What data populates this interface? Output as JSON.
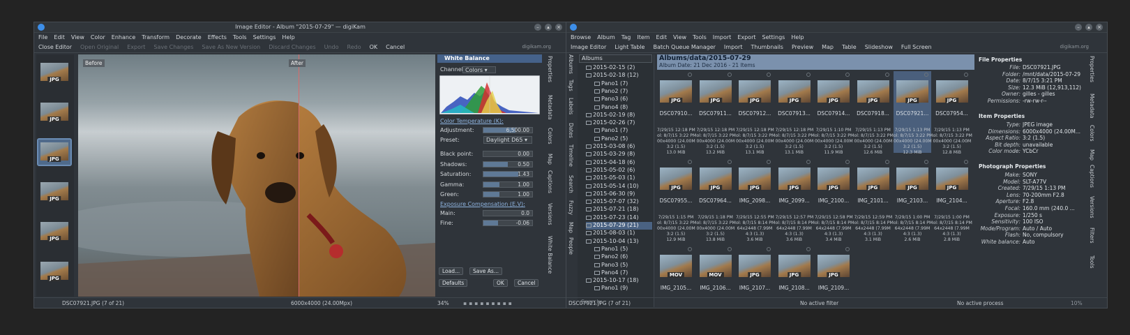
{
  "editor": {
    "title": "Image Editor - Album \"2015-07-29\" — digiKam",
    "menu": [
      "File",
      "Edit",
      "View",
      "Color",
      "Enhance",
      "Transform",
      "Decorate",
      "Effects",
      "Tools",
      "Settings",
      "Help"
    ],
    "toolbar": [
      {
        "label": "Close Editor",
        "enabled": true
      },
      {
        "label": "Open Original",
        "enabled": false
      },
      {
        "label": "Export",
        "enabled": false
      },
      {
        "label": "Save Changes",
        "enabled": false
      },
      {
        "label": "Save As New Version",
        "enabled": false
      },
      {
        "label": "Discard Changes",
        "enabled": false
      },
      {
        "label": "Undo",
        "enabled": false
      },
      {
        "label": "Redo",
        "enabled": false
      },
      {
        "label": "OK",
        "enabled": true
      },
      {
        "label": "Cancel",
        "enabled": true
      }
    ],
    "org": "digikam.org",
    "before_label": "Before",
    "after_label": "After",
    "tool_title": "White Balance",
    "channel_label": "Channel:",
    "channel_value": "Colors",
    "color_temp_label": "Color Temperature (K):",
    "adjustment_label": "Adjustment:",
    "adjustment_value": "6,500.00",
    "adjustment_level": 0.65,
    "preset_label": "Preset:",
    "preset_value": "Daylight D65",
    "sliders": [
      {
        "label": "Black point:",
        "value": "0.00",
        "level": 0.0
      },
      {
        "label": "Shadows:",
        "value": "0.50",
        "level": 0.5
      },
      {
        "label": "Saturation:",
        "value": "1.43",
        "level": 0.71
      },
      {
        "label": "Gamma:",
        "value": "1.00",
        "level": 0.33
      },
      {
        "label": "Green:",
        "value": "1.00",
        "level": 0.33
      }
    ],
    "exposure_label": "Exposure Compensation (E.V):",
    "main_label": "Main:",
    "main_value": "0.0",
    "main_level": 0.0,
    "fine_label": "Fine:",
    "fine_value": "-0.06",
    "fine_level": 0.3,
    "load_btn": "Load...",
    "saveas_btn": "Save As...",
    "defaults_btn": "Defaults",
    "ok_btn": "OK",
    "cancel_btn": "Cancel",
    "status_file": "DSC07921.JPG (7 of 21)",
    "status_size": "6000x4000 (24.00Mpx)",
    "zoom": "34%",
    "side_tabs": [
      "Properties",
      "Metadata",
      "Colors",
      "Map",
      "Captions",
      "Versions",
      "White Balance"
    ],
    "thumb_label": "JPG"
  },
  "browser": {
    "menu": [
      "Browse",
      "Album",
      "Tag",
      "Item",
      "Edit",
      "View",
      "Tools",
      "Import",
      "Export",
      "Settings",
      "Help"
    ],
    "toolbar": [
      "Image Editor",
      "Light Table",
      "Batch Queue Manager",
      "Import",
      "Thumbnails",
      "Preview",
      "Map",
      "Table",
      "Slideshow",
      "Full Screen"
    ],
    "org": "digikam.org",
    "left_tabs": [
      "Albums",
      "Tags",
      "Labels",
      "Dates",
      "Timeline",
      "Search",
      "Fuzzy",
      "Map",
      "People"
    ],
    "right_tabs": [
      "Properties",
      "Metadata",
      "Colors",
      "Map",
      "Captions",
      "Versions",
      "Filters",
      "Tools"
    ],
    "tree_header": "Albums",
    "tree": [
      {
        "label": "2015-02-15 (2)",
        "level": 1
      },
      {
        "label": "2015-02-18 (12)",
        "level": 1
      },
      {
        "label": "Pano1 (7)",
        "level": 2
      },
      {
        "label": "Pano2 (7)",
        "level": 2
      },
      {
        "label": "Pano3 (6)",
        "level": 2
      },
      {
        "label": "Pano4 (8)",
        "level": 2
      },
      {
        "label": "2015-02-19 (8)",
        "level": 1
      },
      {
        "label": "2015-02-26 (7)",
        "level": 1
      },
      {
        "label": "Pano1 (7)",
        "level": 2
      },
      {
        "label": "Pano2 (5)",
        "level": 2
      },
      {
        "label": "2015-03-08 (6)",
        "level": 1
      },
      {
        "label": "2015-03-29 (8)",
        "level": 1
      },
      {
        "label": "2015-04-18 (6)",
        "level": 1
      },
      {
        "label": "2015-05-02 (6)",
        "level": 1
      },
      {
        "label": "2015-05-03 (1)",
        "level": 1
      },
      {
        "label": "2015-05-14 (10)",
        "level": 1
      },
      {
        "label": "2015-06-30 (9)",
        "level": 1
      },
      {
        "label": "2015-07-07 (32)",
        "level": 1
      },
      {
        "label": "2015-07-21 (18)",
        "level": 1
      },
      {
        "label": "2015-07-23 (14)",
        "level": 1
      },
      {
        "label": "2015-07-29 (21)",
        "level": 1,
        "selected": true
      },
      {
        "label": "2015-08-03 (1)",
        "level": 1
      },
      {
        "label": "2015-10-04 (13)",
        "level": 1
      },
      {
        "label": "Pano1 (5)",
        "level": 2
      },
      {
        "label": "Pano2 (6)",
        "level": 2
      },
      {
        "label": "Pano3 (5)",
        "level": 2
      },
      {
        "label": "Pano4 (7)",
        "level": 2
      },
      {
        "label": "2015-10-17 (18)",
        "level": 1
      },
      {
        "label": "Pano1 (9)",
        "level": 2
      }
    ],
    "search_placeholder": "Search...",
    "album_path": "Albums/data/2015-07-29",
    "album_date": "Album Date: 21 Dec 2016 - 21 Items",
    "items": [
      {
        "name": "DSC07910...",
        "type": "JPG",
        "meta": "7/29/15 12:18 PM\nol: 8/7/15 3:22 PM\n00x4000 (24.00M\n3:2 (1.5)\n13.0 MiB"
      },
      {
        "name": "DSC07911...",
        "type": "JPG",
        "meta": "7/29/15 12:18 PM\nol: 8/7/15 3:22 PM\n00x4000 (24.00M\n3:2 (1.5)\n13.2 MiB"
      },
      {
        "name": "DSC07912...",
        "type": "JPG",
        "meta": "7/29/15 12:18 PM\nol: 8/7/15 3:22 PM\n00x4000 (24.00M\n3:2 (1.5)\n13.1 MiB"
      },
      {
        "name": "DSC07913...",
        "type": "JPG",
        "meta": "7/29/15 12:18 PM\nol: 8/7/15 3:22 PM\n00x4000 (24.00M\n3:2 (1.5)\n13.1 MiB"
      },
      {
        "name": "DSC07914...",
        "type": "JPG",
        "meta": "7/29/15 1:10 PM\nol: 8/7/15 3:22 PM\n00x4000 (24.00M\n3:2 (1.5)\n11.9 MiB"
      },
      {
        "name": "DSC07918...",
        "type": "JPG",
        "meta": "7/29/15 1:13 PM\nol: 8/7/15 3:22 PM\n00x4000 (24.00M\n3:2 (1.5)\n12.6 MiB"
      },
      {
        "name": "DSC07921...",
        "type": "JPG",
        "meta": "7/29/15 1:13 PM\nol: 8/7/15 3:22 PM\n00x4000 (24.00M\n3:2 (1.5)\n12.3 MiB",
        "selected": true
      },
      {
        "name": "DSC07954...",
        "type": "JPG",
        "meta": "7/29/15 1:13 PM\nol: 8/7/15 3:22 PM\n00x4000 (24.00M\n3:2 (1.5)\n12.8 MiB"
      },
      {
        "name": "DSC07955...",
        "type": "JPG",
        "meta": "7/29/15 1:15 PM\nol: 8/7/15 3:22 PM\n00x4000 (24.00M\n3:2 (1.5)\n12.9 MiB"
      },
      {
        "name": "DSC07964...",
        "type": "JPG",
        "meta": "7/29/15 1:18 PM\nol: 8/7/15 3:22 PM\n00x4000 (24.00M\n3:2 (1.5)\n13.8 MiB"
      },
      {
        "name": "IMG_2098...",
        "type": "JPG",
        "meta": "7/29/15 12:55 PM\nol: 8/7/15 8:14 PM\n64x2448 (7.99M\n4:3 (1.3)\n3.6 MiB"
      },
      {
        "name": "IMG_2099...",
        "type": "JPG",
        "meta": "7/29/15 12:57 PM\nol: 8/7/15 8:14 PM\n64x2448 (7.99M\n4:3 (1.3)\n3.6 MiB"
      },
      {
        "name": "IMG_2100...",
        "type": "JPG",
        "meta": "7/29/15 12:58 PM\nol: 8/7/15 8:14 PM\n64x2448 (7.99M\n4:3 (1.3)\n3.4 MiB"
      },
      {
        "name": "IMG_2101...",
        "type": "JPG",
        "meta": "7/29/15 12:59 PM\nol: 8/7/15 8:14 PM\n64x2448 (7.99M\n4:3 (1.3)\n3.1 MiB"
      },
      {
        "name": "IMG_2103...",
        "type": "JPG",
        "meta": "7/29/15 1:00 PM\nol: 8/7/15 8:14 PM\n64x2448 (7.99M\n4:3 (1.3)\n2.6 MiB"
      },
      {
        "name": "IMG_2104...",
        "type": "JPG",
        "meta": "7/29/15 1:00 PM\nol: 8/7/15 8:14 PM\n64x2448 (7.99M\n4:3 (1.3)\n2.8 MiB"
      },
      {
        "name": "IMG_2105...",
        "type": "MOV",
        "meta": ""
      },
      {
        "name": "IMG_2106...",
        "type": "MOV",
        "meta": ""
      },
      {
        "name": "IMG_2107...",
        "type": "JPG",
        "meta": ""
      },
      {
        "name": "IMG_2108...",
        "type": "JPG",
        "meta": ""
      },
      {
        "name": "IMG_2109...",
        "type": "JPG",
        "meta": ""
      }
    ],
    "file_props_title": "File Properties",
    "file_props": [
      [
        "File:",
        "DSC07921.JPG"
      ],
      [
        "Folder:",
        "/mnt/data/2015-07-29"
      ],
      [
        "Date:",
        "8/7/15 3:21 PM"
      ],
      [
        "Size:",
        "12.3 MiB (12,913,112)"
      ],
      [
        "Owner:",
        "gilles - gilles"
      ],
      [
        "Permissions:",
        "-rw-rw-r--"
      ]
    ],
    "item_props_title": "Item Properties",
    "item_props": [
      [
        "Type:",
        "JPEG image"
      ],
      [
        "Dimensions:",
        "6000x4000 (24.00M..."
      ],
      [
        "Aspect Ratio:",
        "3:2 (1.5)"
      ],
      [
        "Bit depth:",
        "unavailable"
      ],
      [
        "Color mode:",
        "YCbCr"
      ]
    ],
    "photo_props_title": "Photograph Properties",
    "photo_props": [
      [
        "Make:",
        "SONY"
      ],
      [
        "Model:",
        "SLT-A77V"
      ],
      [
        "Created:",
        "7/29/15 1:13 PM"
      ],
      [
        "Lens:",
        "70-200mm F2.8"
      ],
      [
        "Aperture:",
        "F2.8"
      ],
      [
        "Focal:",
        "160.0 mm (240.0 ..."
      ],
      [
        "Exposure:",
        "1/250 s"
      ],
      [
        "Sensitivity:",
        "100 ISO"
      ],
      [
        "Mode/Program:",
        "Auto / Auto"
      ],
      [
        "Flash:",
        "No, compulsory"
      ],
      [
        "White balance:",
        "Auto"
      ]
    ],
    "status_file": "DSC07921.JPG (7 of 21)",
    "status_filter": "No active filter",
    "status_process": "No active process",
    "zoom": "10%"
  }
}
